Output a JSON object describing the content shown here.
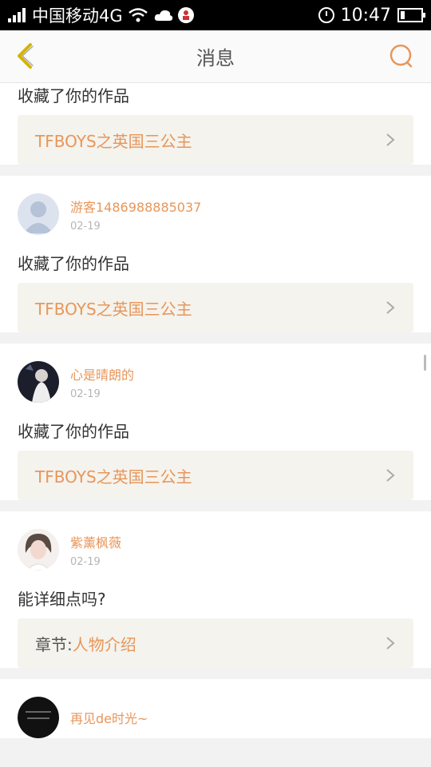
{
  "status": {
    "carrier": "中国移动4G",
    "time": "10:47"
  },
  "nav": {
    "title": "消息"
  },
  "messages": [
    {
      "text": "收藏了你的作品",
      "work": "TFBOYS之英国三公主"
    },
    {
      "user": "游客1486988885037",
      "date": "02-19",
      "text": "收藏了你的作品",
      "work": "TFBOYS之英国三公主"
    },
    {
      "user": "心是晴朗的",
      "date": "02-19",
      "text": "收藏了你的作品",
      "work": "TFBOYS之英国三公主"
    },
    {
      "user": "紫薰枫薇",
      "date": "02-19",
      "text": "能详细点吗?",
      "work_prefix": "章节:",
      "work": "人物介绍"
    },
    {
      "user": "再见de时光~"
    }
  ],
  "colors": {
    "accent": "#e8965a",
    "card_bg": "#f4f3ed",
    "back_icon": "#d4b400"
  }
}
